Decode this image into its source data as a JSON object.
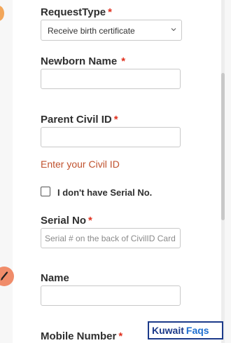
{
  "form": {
    "request_type": {
      "label": "RequestType",
      "required": "*",
      "value": "Receive birth certificate"
    },
    "newborn_name": {
      "label": "Newborn Name",
      "required": "*",
      "value": ""
    },
    "parent_civil_id": {
      "label": "Parent Civil ID",
      "required": "*",
      "value": "",
      "hint": "Enter your Civil ID"
    },
    "no_serial": {
      "label": "I don't have Serial No.",
      "checked": false
    },
    "serial_no": {
      "label": "Serial No",
      "required": "*",
      "placeholder": "Serial # on the back of CivilID Card"
    },
    "name": {
      "label": "Name",
      "value": ""
    },
    "mobile_number": {
      "label": "Mobile Number",
      "required": "*"
    }
  },
  "icons": {
    "select_chevron": "chevron-down-icon",
    "edit": "pencil-icon"
  },
  "watermark": {
    "part1": "Kuwait",
    "part2": "Faqs"
  },
  "colors": {
    "required": "#e0301e",
    "hint": "#c0522e",
    "edit_button": "#f08c6a",
    "watermark_border": "#1c3a8a"
  }
}
